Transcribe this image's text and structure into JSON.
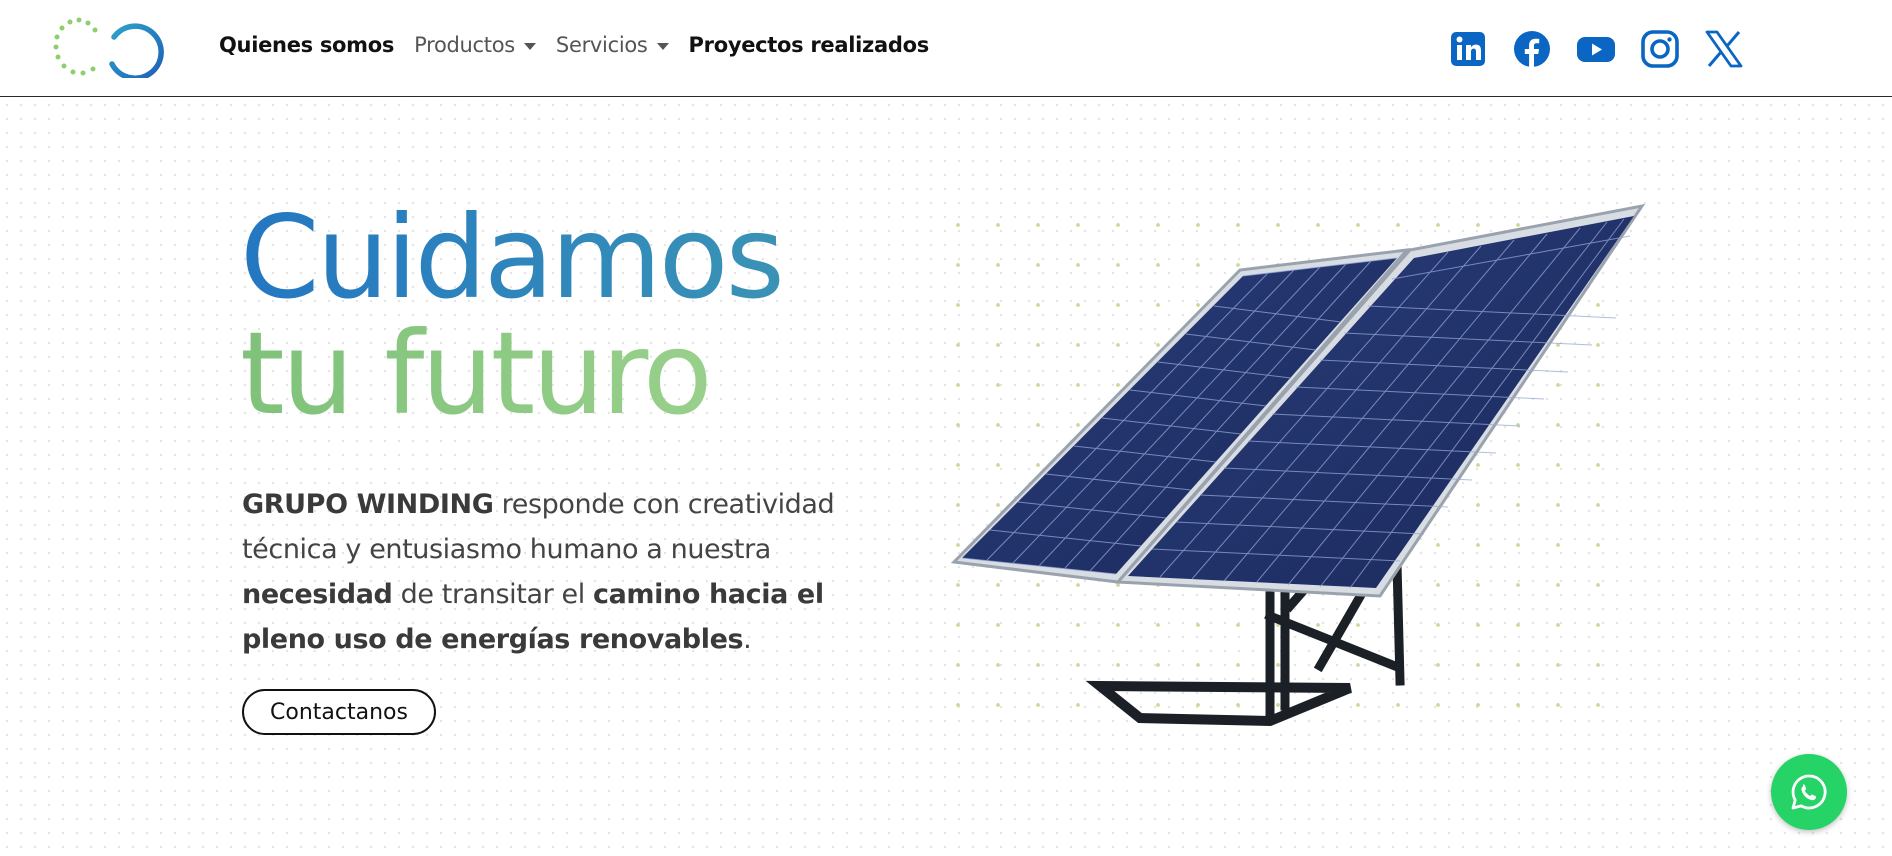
{
  "brand": {
    "logo_icon": "grupo-winding-logo"
  },
  "nav": {
    "items": [
      {
        "label": "Quienes somos",
        "dropdown": false
      },
      {
        "label": "Productos",
        "dropdown": true
      },
      {
        "label": "Servicios",
        "dropdown": true
      },
      {
        "label": "Proyectos realizados",
        "dropdown": false
      }
    ]
  },
  "socials": [
    {
      "icon": "linkedin-icon",
      "color": "#0a66c2"
    },
    {
      "icon": "facebook-icon",
      "color": "#0a66c2"
    },
    {
      "icon": "youtube-icon",
      "color": "#0a66c2"
    },
    {
      "icon": "instagram-icon",
      "color": "#0a66c2"
    },
    {
      "icon": "x-icon",
      "color": "#0a66c2"
    }
  ],
  "hero": {
    "headline_line1": "Cuidamos",
    "headline_line2": "tu futuro",
    "intro": {
      "p1_bold": "GRUPO WINDING",
      "p1": " responde con creatividad técnica y entusiasmo humano a nuestra ",
      "p2_bold": "necesidad",
      "p2": " de transitar el ",
      "p3_bold": "camino hacia el pleno uso de energías renovables",
      "p3": "."
    },
    "cta_label": "Contactanos",
    "image_alt_icon": "solar-panel-image"
  },
  "colors": {
    "headline_blue": "#2377c2",
    "headline_green": "#8cc97f",
    "accent_social": "#0a66c2",
    "whatsapp": "#25d366"
  },
  "whatsapp": {
    "icon": "whatsapp-icon"
  }
}
